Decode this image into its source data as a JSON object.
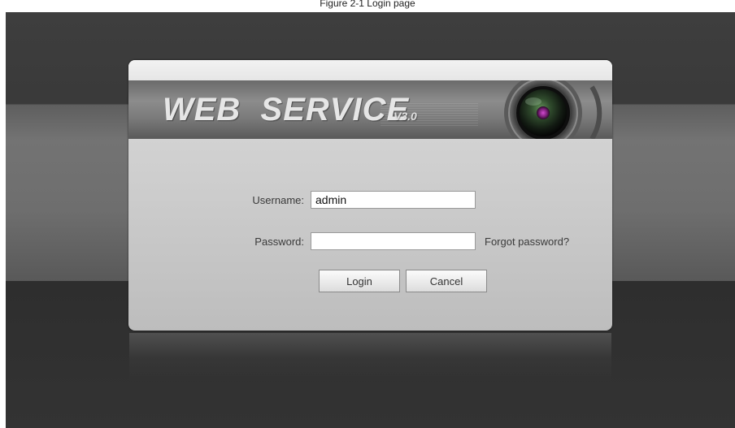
{
  "page": {
    "caption": "Figure 2-1 Login page"
  },
  "banner": {
    "title": "WEB  SERVICE",
    "version": "V3.0",
    "lens_icon": "camera-lens-icon"
  },
  "login": {
    "username_label": "Username:",
    "username_value": "admin",
    "password_label": "Password:",
    "password_value": "",
    "forgot_label": "Forgot password?",
    "login_button": "Login",
    "cancel_button": "Cancel"
  },
  "colors": {
    "background": "#363636",
    "panel": "#cfcfcf",
    "banner": "#7a7a7a"
  }
}
